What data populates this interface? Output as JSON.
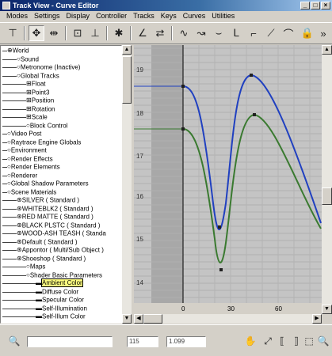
{
  "window": {
    "title": "Track View - Curve Editor",
    "minimize": "_",
    "maximize": "□",
    "close": "×"
  },
  "menu": [
    "Modes",
    "Settings",
    "Display",
    "Controller",
    "Tracks",
    "Keys",
    "Curves",
    "Utilities"
  ],
  "tree": {
    "items": [
      {
        "label": "World",
        "type": "root"
      },
      {
        "label": "Sound",
        "type": "sub"
      },
      {
        "label": "Metronome (Inactive)",
        "type": "sub"
      },
      {
        "label": "Global Tracks",
        "type": "sub"
      },
      {
        "label": "Float",
        "type": "track"
      },
      {
        "label": "Point3",
        "type": "track"
      },
      {
        "label": "Position",
        "type": "track"
      },
      {
        "label": "Rotation",
        "type": "track"
      },
      {
        "label": "Scale",
        "type": "track"
      },
      {
        "label": "Block Control",
        "type": "sub"
      },
      {
        "label": "Video Post",
        "type": "sub"
      },
      {
        "label": "Raytrace Engine Globals",
        "type": "sub"
      },
      {
        "label": "Environment",
        "type": "sub"
      },
      {
        "label": "Render Effects",
        "type": "sub"
      },
      {
        "label": "Render Elements",
        "type": "sub"
      },
      {
        "label": "Renderer",
        "type": "sub"
      },
      {
        "label": "Global Shadow Parameters",
        "type": "sub"
      },
      {
        "label": "Scene Materials",
        "type": "sub"
      },
      {
        "label": "SILVER ( Standard )",
        "type": "mat"
      },
      {
        "label": "WHITEBLK2 ( Standard )",
        "type": "mat"
      },
      {
        "label": "RED MATTE ( Standard )",
        "type": "mat"
      },
      {
        "label": "BLACK PLSTC ( Standard )",
        "type": "mat"
      },
      {
        "label": "WOOD-ASH TEASH ( Standa",
        "type": "mat"
      },
      {
        "label": "Default ( Standard )",
        "type": "mat"
      },
      {
        "label": "Appontor ( Multi/Sub Object )",
        "type": "mat"
      },
      {
        "label": "Shoeshop ( Standard )",
        "type": "mat"
      },
      {
        "label": "Maps",
        "type": "sub"
      },
      {
        "label": "Shader Basic Parameters",
        "type": "sub"
      },
      {
        "label": "Ambient Color",
        "type": "param",
        "selected": true
      },
      {
        "label": "Diffuse Color",
        "type": "param"
      },
      {
        "label": "Specular Color",
        "type": "param"
      },
      {
        "label": "Self-Illumination",
        "type": "param"
      },
      {
        "label": "Self-Illum Color",
        "type": "param"
      }
    ]
  },
  "curve_editor": {
    "y_ticks": [
      "19",
      "18",
      "17",
      "16",
      "15",
      "14"
    ],
    "x_ticks": [
      "0",
      "30",
      "60"
    ],
    "colors": {
      "blue_curve": "#2040c0",
      "green_curve": "#3a7a30",
      "background": "#c4c4c4",
      "inactive": "#a8a8a8"
    }
  },
  "status": {
    "frame_field": "115",
    "value_field": "1.099",
    "left_field": ""
  }
}
